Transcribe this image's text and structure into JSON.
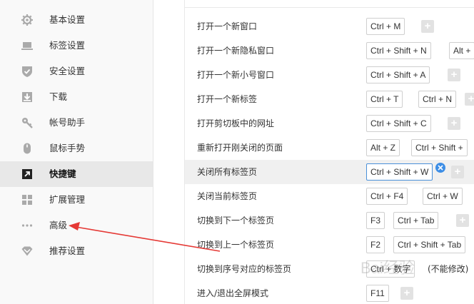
{
  "sidebar": {
    "items": [
      {
        "label": "基本设置",
        "icon": "gear-icon"
      },
      {
        "label": "标签设置",
        "icon": "laptop-icon"
      },
      {
        "label": "安全设置",
        "icon": "shield-check-icon"
      },
      {
        "label": "下载",
        "icon": "download-icon"
      },
      {
        "label": "帐号助手",
        "icon": "key-icon"
      },
      {
        "label": "鼠标手势",
        "icon": "mouse-icon"
      },
      {
        "label": "快捷键",
        "icon": "arrow-up-right-icon"
      },
      {
        "label": "扩展管理",
        "icon": "grid-icon"
      },
      {
        "label": "高级",
        "icon": "more-dots-icon"
      },
      {
        "label": "推荐设置",
        "icon": "diamond-icon"
      }
    ],
    "active_index": 6
  },
  "shortcuts": [
    {
      "action": "打开一个新窗口",
      "keys": [
        "Ctrl + M"
      ]
    },
    {
      "action": "打开一个新隐私窗口",
      "keys": [
        "Ctrl + Shift + N",
        "Alt +"
      ]
    },
    {
      "action": "打开一个新小号窗口",
      "keys": [
        "Ctrl + Shift + A"
      ]
    },
    {
      "action": "打开一个新标签",
      "keys": [
        "Ctrl + T",
        "Ctrl + N"
      ]
    },
    {
      "action": "打开剪切板中的网址",
      "keys": [
        "Ctrl + Shift + C"
      ]
    },
    {
      "action": "重新打开刚关闭的页面",
      "keys": [
        "Alt + Z",
        "Ctrl + Shift +"
      ]
    },
    {
      "action": "关闭所有标签页",
      "keys": [
        "Ctrl + Shift + W"
      ]
    },
    {
      "action": "关闭当前标签页",
      "keys": [
        "Ctrl + F4",
        "Ctrl + W"
      ]
    },
    {
      "action": "切换到下一个标签页",
      "keys": [
        "F3",
        "Ctrl + Tab"
      ]
    },
    {
      "action": "切换到上一个标签页",
      "keys": [
        "F2",
        "Ctrl + Shift + Tab"
      ]
    },
    {
      "action": "切换到序号对应的标签页",
      "keys": [
        "Ctrl + 数字"
      ],
      "note": "(不能修改)"
    },
    {
      "action": "进入/退出全屏模式",
      "keys": [
        "F11"
      ]
    }
  ],
  "add_symbol": "+",
  "watermark": "Bai经验",
  "colors": {
    "accent": "#3d8ee6",
    "arrow": "#e53935",
    "add_button": "#e2e2e2"
  }
}
